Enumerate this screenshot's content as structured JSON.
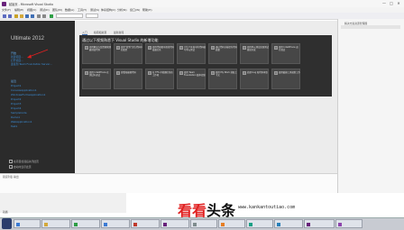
{
  "window": {
    "title": "起始页 - Microsoft Visual Studio",
    "controls": [
      "—",
      "□",
      "✕"
    ]
  },
  "menu": [
    "文件(F)",
    "编辑(E)",
    "视图(V)",
    "调试(D)",
    "团队(M)",
    "数据(A)",
    "工具(T)",
    "测试(S)",
    "体系结构(C)",
    "分析(N)",
    "窗口(W)",
    "帮助(H)"
  ],
  "start_page": {
    "product": "Ultimate 2012",
    "start_heading": "开始",
    "start_links": [
      "新建项目...",
      "打开项目...",
      "连接到 Team Foundation Server..."
    ],
    "recent_heading": "最近",
    "recent_links": [
      "Project1",
      "ConsoleApplication1",
      "WindowsFormsApplication1",
      "Project2",
      "Project3",
      "Project4",
      "SampleCode",
      "Demo1",
      "WebApplication1",
      "Test1"
    ],
    "options": [
      "在项目加载后关闭此页",
      "启动时显示此页"
    ],
    "tabs": [
      "入门",
      "指南和资源",
      "最新新闻"
    ],
    "tiles_heading": "通过以下视频熟悉下 Visual Studio 的新增功能",
    "tiles": [
      "使用解决方案资源管理器浏览代码",
      "使用“转到”定位代码中的类型",
      "使用代码图可视化代码依赖关系",
      "为生产环境中的代码编写单元测试",
      "通过代码分析提升代码质量",
      "使用单元测试实现测试驱动开发",
      "使用 IntelliTrace 进行调试",
      "使用 IntelliTrace 在测试中调试",
      "查看和编辑代码",
      "在 TFS 中管理任务和工作项",
      "使用 Team Foundation 版本控制",
      "使用 My Work 获取上下文",
      "处理 bug 和代码审查",
      "使用敏捷工具规划工作"
    ]
  },
  "solution_explorer": {
    "title": "解决方案资源管理器"
  },
  "output": {
    "title": "错误列表 输出"
  },
  "status": {
    "text": "就绪"
  },
  "taskbar": {
    "items": [
      "",
      "",
      "",
      "",
      "",
      "",
      "",
      "",
      "",
      "",
      "",
      ""
    ]
  },
  "watermark": {
    "main_red": "看看",
    "main_black": "头条",
    "url": "www.kankantoutiao.com"
  },
  "colors": {
    "start_dark": "#2b2b2b",
    "link_blue": "#3c8fd9",
    "vs_purple": "#68217a",
    "arrow_red": "#e02020"
  }
}
